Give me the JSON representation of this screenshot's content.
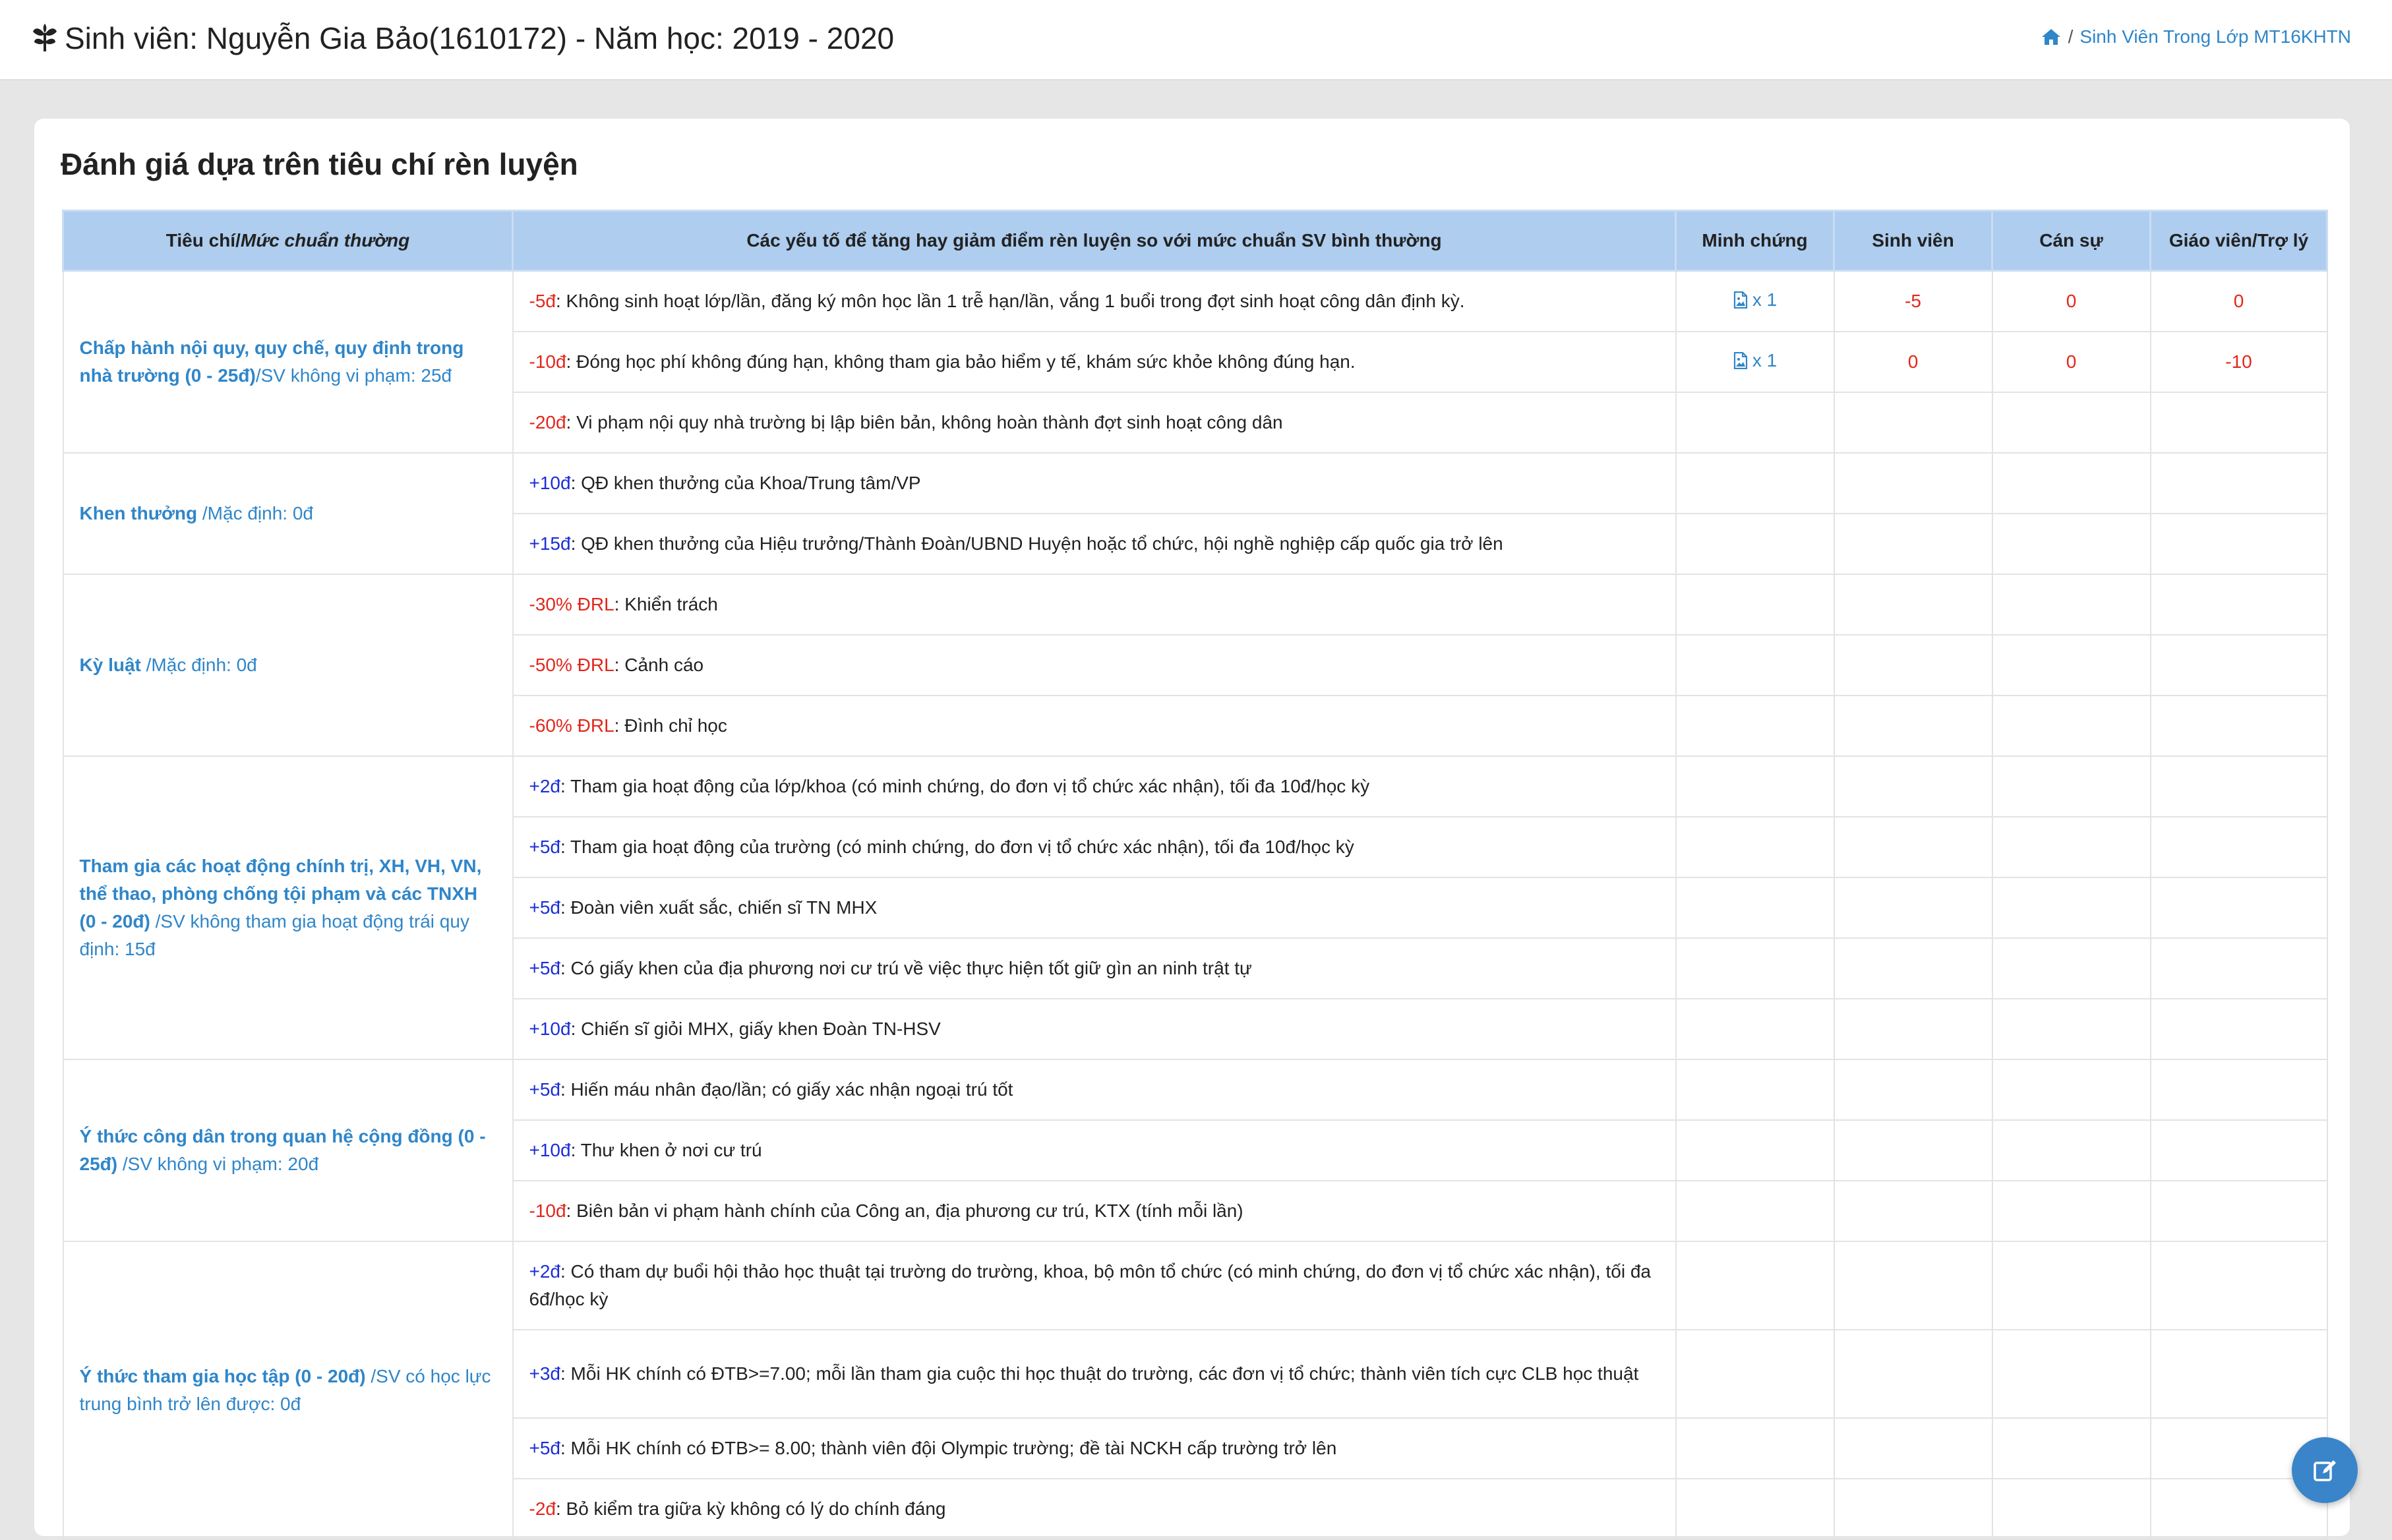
{
  "header": {
    "title": "Sinh viên: Nguyễn Gia Bảo(1610172) - Năm học: 2019 - 2020",
    "breadcrumb_sep": "/",
    "breadcrumb_link": "Sinh Viên Trong Lớp MT16KHTN"
  },
  "card": {
    "title": "Đánh giá dựa trên tiêu chí rèn luyện"
  },
  "table": {
    "headers": {
      "criteria_a": "Tiêu chí/",
      "criteria_b": "Mức chuẩn thường",
      "factors": "Các yếu tố để tăng hay giảm điểm rèn luyện so với mức chuẩn SV bình thường",
      "evidence": "Minh chứng",
      "student": "Sinh viên",
      "officer": "Cán sự",
      "teacher": "Giáo viên/Trợ lý"
    },
    "groups": [
      {
        "criteria": "Chấp hành nội quy, quy chế, quy định trong nhà trường (0 - 25đ)",
        "standard": "/SV không vi phạm: 25đ",
        "rows": [
          {
            "points": "-5đ",
            "sign": "neg",
            "text": ": Không sinh hoạt lớp/lần, đăng ký môn học lần 1 trễ hạn/lần, vắng 1 buổi trong đợt sinh hoạt công dân định kỳ.",
            "evidence": "x 1",
            "student": "-5",
            "officer": "0",
            "teacher": "0"
          },
          {
            "points": "-10đ",
            "sign": "neg",
            "text": ": Đóng học phí không đúng hạn, không tham gia bảo hiểm y tế, khám sức khỏe không đúng hạn.",
            "evidence": "x 1",
            "student": "0",
            "officer": "0",
            "teacher": "-10"
          },
          {
            "points": "-20đ",
            "sign": "neg",
            "text": ": Vi phạm nội quy nhà trường bị lập biên bản, không hoàn thành đợt sinh hoạt công dân"
          }
        ]
      },
      {
        "criteria": "Khen thưởng",
        "standard": " /Mặc định: 0đ",
        "rows": [
          {
            "points": "+10đ",
            "sign": "pos",
            "text": ": QĐ khen thưởng của Khoa/Trung tâm/VP"
          },
          {
            "points": "+15đ",
            "sign": "pos",
            "text": ": QĐ khen thưởng của Hiệu trưởng/Thành Đoàn/UBND Huyện hoặc tổ chức, hội nghề nghiệp cấp quốc gia trở lên"
          }
        ]
      },
      {
        "criteria": "Kỳ luật",
        "standard": " /Mặc định: 0đ",
        "rows": [
          {
            "points": "-30% ĐRL",
            "sign": "neg",
            "text": ": Khiển trách"
          },
          {
            "points": "-50% ĐRL",
            "sign": "neg",
            "text": ": Cảnh cáo"
          },
          {
            "points": "-60% ĐRL",
            "sign": "neg",
            "text": ": Đình chỉ học"
          }
        ]
      },
      {
        "criteria": "Tham gia các hoạt động chính trị, XH, VH, VN, thể thao, phòng chống tội phạm và các TNXH (0 - 20đ)",
        "standard": " /SV không tham gia hoạt động trái quy định: 15đ",
        "rows": [
          {
            "points": "+2đ",
            "sign": "pos",
            "text": ": Tham gia hoạt động của lớp/khoa (có minh chứng, do đơn vị tổ chức xác nhận), tối đa 10đ/học kỳ"
          },
          {
            "points": "+5đ",
            "sign": "pos",
            "text": ": Tham gia hoạt động của trường (có minh chứng, do đơn vị tổ chức xác nhận), tối đa 10đ/học kỳ"
          },
          {
            "points": "+5đ",
            "sign": "pos",
            "text": ": Đoàn viên xuất sắc, chiến sĩ TN MHX"
          },
          {
            "points": "+5đ",
            "sign": "pos",
            "text": ": Có giấy khen của địa phương nơi cư trú về việc thực hiện tốt giữ gìn an ninh trật tự"
          },
          {
            "points": "+10đ",
            "sign": "pos",
            "text": ": Chiến sĩ giỏi MHX, giấy khen Đoàn TN-HSV"
          }
        ]
      },
      {
        "criteria": "Ý thức công dân trong quan hệ cộng đồng (0 - 25đ)",
        "standard": " /SV không vi phạm: 20đ",
        "rows": [
          {
            "points": "+5đ",
            "sign": "pos",
            "text": ": Hiến máu nhân đạo/lần; có giấy xác nhận ngoại trú tốt"
          },
          {
            "points": "+10đ",
            "sign": "pos",
            "text": ": Thư khen ở nơi cư trú"
          },
          {
            "points": "-10đ",
            "sign": "neg",
            "text": ": Biên bản vi phạm hành chính của Công an, địa phương cư trú, KTX (tính mỗi lần)"
          }
        ]
      },
      {
        "criteria": "Ý thức tham gia học tập (0 - 20đ)",
        "standard": " /SV có học lực trung bình trở lên được: 0đ",
        "rows": [
          {
            "points": "+2đ",
            "sign": "pos",
            "text": ": Có tham dự buổi hội thảo học thuật tại trường do trường, khoa, bộ môn tổ chức (có minh chứng, do đơn vị tổ chức xác nhận), tối đa 6đ/học kỳ"
          },
          {
            "points": "+3đ",
            "sign": "pos",
            "text": ": Mỗi HK chính có ĐTB>=7.00; mỗi lần tham gia cuộc thi học thuật do trường, các đơn vị tổ chức; thành viên tích cực CLB học thuật"
          },
          {
            "points": "+5đ",
            "sign": "pos",
            "text": ": Mỗi HK chính có ĐTB>= 8.00; thành viên đội Olympic trường; đề tài NCKH cấp trường trở lên"
          },
          {
            "points": "-2đ",
            "sign": "neg",
            "text": ": Bỏ kiểm tra giữa kỳ không có lý do chính đáng"
          }
        ]
      }
    ]
  },
  "fab": {
    "icon": "edit-icon"
  }
}
